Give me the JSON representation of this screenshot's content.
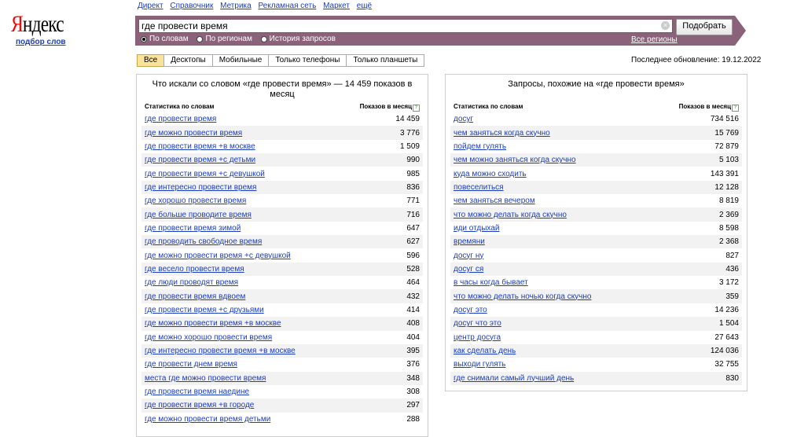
{
  "logo": {
    "first": "Я",
    "rest": "ндекс",
    "sub": "подбор слов"
  },
  "topnav": [
    "Директ",
    "Справочник",
    "Метрика",
    "Рекламная сеть",
    "Маркет",
    "ещё"
  ],
  "search": {
    "value": "где провести время",
    "button": "Подобрать"
  },
  "radios": [
    {
      "label": "По словам",
      "checked": true
    },
    {
      "label": "По регионам",
      "checked": false
    },
    {
      "label": "История запросов",
      "checked": false
    }
  ],
  "regions_link": "Все регионы",
  "tabs": [
    "Все",
    "Десктопы",
    "Мобильные",
    "Только телефоны",
    "Только планшеты"
  ],
  "updated": "Последнее обновление: 19.12.2022",
  "left": {
    "title": "Что искали со словом «где провести время» — 14 459 показов в месяц",
    "col1": "Статистика по словам",
    "col2": "Показов в месяц",
    "rows": [
      [
        "где провести время",
        "14 459"
      ],
      [
        "где можно провести время",
        "3 776"
      ],
      [
        "где провести время +в москве",
        "1 509"
      ],
      [
        "где провести время +с детьми",
        "990"
      ],
      [
        "где провести время +с девушкой",
        "985"
      ],
      [
        "где интересно провести время",
        "836"
      ],
      [
        "где хорошо провести время",
        "771"
      ],
      [
        "где больше проводите время",
        "716"
      ],
      [
        "где провести время зимой",
        "647"
      ],
      [
        "где проводить свободное время",
        "627"
      ],
      [
        "где можно провести время +с девушкой",
        "596"
      ],
      [
        "где весело провести время",
        "528"
      ],
      [
        "где люди проводят время",
        "464"
      ],
      [
        "где провести время вдвоем",
        "432"
      ],
      [
        "где провести время +с друзьями",
        "414"
      ],
      [
        "где можно провести время +в москве",
        "408"
      ],
      [
        "где можно хорошо провести время",
        "404"
      ],
      [
        "где интересно провести время +в москве",
        "395"
      ],
      [
        "где провести днем время",
        "376"
      ],
      [
        "места где можно провести время",
        "348"
      ],
      [
        "где провести время наедине",
        "308"
      ],
      [
        "где провести время +в городе",
        "297"
      ],
      [
        "где можно провести время детьми",
        "288"
      ]
    ]
  },
  "right": {
    "title": "Запросы, похожие на «где провести время»",
    "col1": "Статистика по словам",
    "col2": "Показов в месяц",
    "rows": [
      [
        "досуг",
        "734 516"
      ],
      [
        "чем заняться когда скучно",
        "15 769"
      ],
      [
        "пойдем гулять",
        "72 879"
      ],
      [
        "чем можно заняться когда скучно",
        "5 103"
      ],
      [
        "куда можно сходить",
        "143 391"
      ],
      [
        "повеселиться",
        "12 128"
      ],
      [
        "чем заняться вечером",
        "8 819"
      ],
      [
        "что можно делать когда скучно",
        "2 369"
      ],
      [
        "иди отдыхай",
        "8 598"
      ],
      [
        "времяни",
        "2 368"
      ],
      [
        "досуг ну",
        "827"
      ],
      [
        "досуг ся",
        "436"
      ],
      [
        "в часы когда бывает",
        "3 172"
      ],
      [
        "что можно делать ночью когда скучно",
        "359"
      ],
      [
        "досуг это",
        "14 236"
      ],
      [
        "досуг что это",
        "1 504"
      ],
      [
        "центр досуга",
        "27 643"
      ],
      [
        "как сделать день",
        "124 036"
      ],
      [
        "выходи гулять",
        "32 755"
      ],
      [
        "где снимали самый лучший день",
        "830"
      ]
    ]
  }
}
